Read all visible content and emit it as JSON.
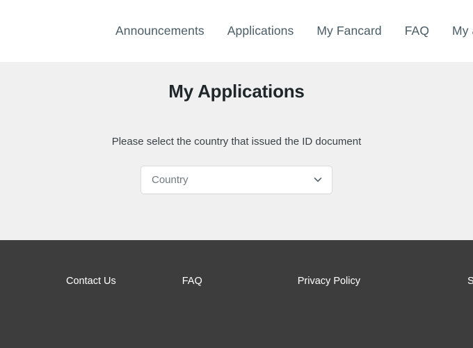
{
  "header": {
    "nav_items": [
      {
        "label": "Announcements",
        "name": "nav-announcements"
      },
      {
        "label": "Applications",
        "name": "nav-applications"
      },
      {
        "label": "My Fancard",
        "name": "nav-my-fancard"
      },
      {
        "label": "FAQ",
        "name": "nav-faq"
      },
      {
        "label": "My account",
        "name": "nav-my-account"
      }
    ]
  },
  "main": {
    "title": "My Applications",
    "prompt": "Please select the country that issued the ID document",
    "country_select": {
      "value": "",
      "placeholder": "Country",
      "icon": "chevron-down-icon"
    }
  },
  "footer": {
    "links": [
      {
        "label": "Contact Us",
        "name": "footer-contact-us"
      },
      {
        "label": "FAQ",
        "name": "footer-faq"
      },
      {
        "label": "Privacy Policy",
        "name": "footer-privacy-policy"
      },
      {
        "label": "SUPPORT",
        "name": "footer-support"
      }
    ]
  },
  "colors": {
    "header_bg": "#ffffff",
    "body_bg": "#f0f0f0",
    "footer_bg": "#3d3d3d",
    "nav_text": "#4a5c66",
    "title_text": "#20272b",
    "footer_text": "#ffffff",
    "select_border": "#dcdcdc",
    "select_placeholder": "#6f7a80"
  }
}
